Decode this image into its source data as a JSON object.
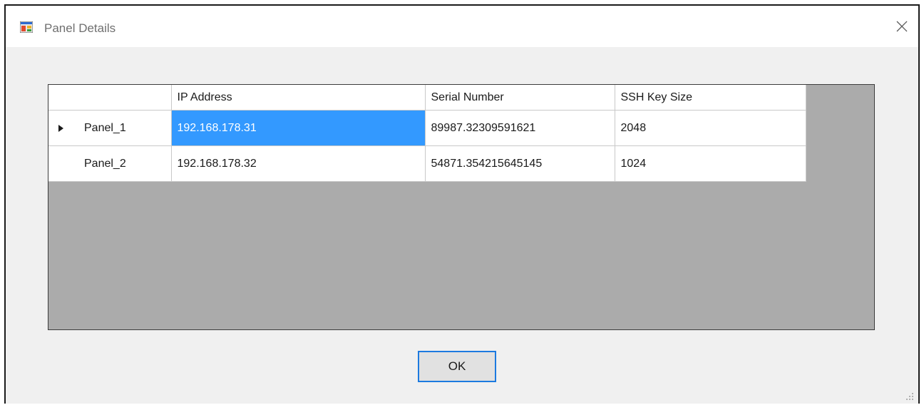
{
  "window": {
    "title": "Panel Details"
  },
  "icons": {
    "app": "form-window-icon",
    "close": "close-icon",
    "row_marker": "row-pointer-icon",
    "grip": "resize-grip-icon"
  },
  "grid": {
    "columns": [
      "IP Address",
      "Serial Number",
      "SSH Key Size"
    ],
    "rows": [
      {
        "header": "Panel_1",
        "ip": "192.168.178.31",
        "serial": "89987.32309591621",
        "key_size": "2048",
        "current": true
      },
      {
        "header": "Panel_2",
        "ip": "192.168.178.32",
        "serial": "54871.354215645145",
        "key_size": "1024",
        "current": false
      }
    ],
    "selected_cell": {
      "row": 0,
      "column": "IP Address"
    }
  },
  "buttons": {
    "ok_label": "OK"
  },
  "colors": {
    "selection": "#3399ff",
    "grid_background": "#ababab",
    "dialog_background": "#f0f0f0",
    "button_focus_border": "#1c7ae0"
  }
}
